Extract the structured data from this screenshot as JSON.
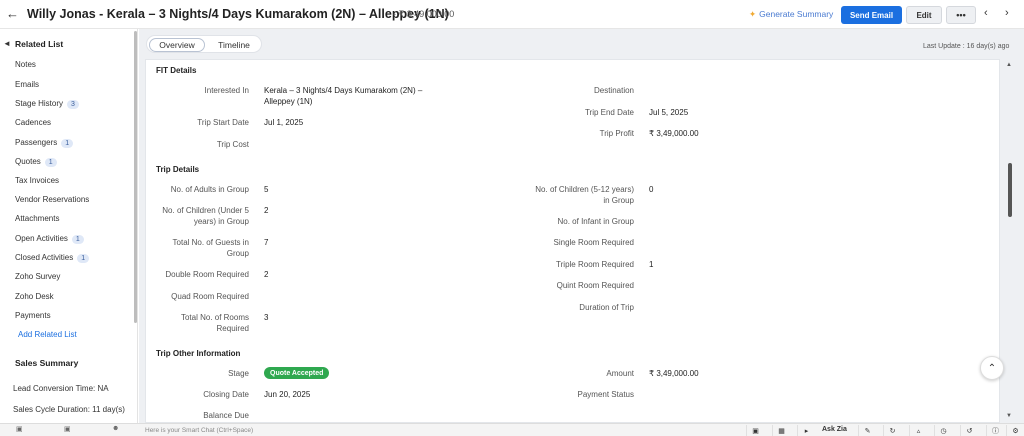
{
  "header": {
    "title": "Willy Jonas - Kerala – 3 Nights/4 Days Kumarakom (2N) – Alleppey (1N)",
    "amount": "- ₹ 3,49,000.00",
    "generate_summary": "Generate Summary",
    "send_email": "Send Email",
    "edit": "Edit",
    "more": "•••"
  },
  "sidebar": {
    "heading": "Related List",
    "items": [
      {
        "label": "Notes",
        "badge": ""
      },
      {
        "label": "Emails",
        "badge": ""
      },
      {
        "label": "Stage History",
        "badge": "3"
      },
      {
        "label": "Cadences",
        "badge": ""
      },
      {
        "label": "Passengers",
        "badge": "1"
      },
      {
        "label": "Quotes",
        "badge": "1"
      },
      {
        "label": "Tax Invoices",
        "badge": ""
      },
      {
        "label": "Vendor Reservations",
        "badge": ""
      },
      {
        "label": "Attachments",
        "badge": ""
      },
      {
        "label": "Open Activities",
        "badge": "1"
      },
      {
        "label": "Closed Activities",
        "badge": "1"
      },
      {
        "label": "Zoho Survey",
        "badge": ""
      },
      {
        "label": "Zoho Desk",
        "badge": ""
      },
      {
        "label": "Payments",
        "badge": ""
      }
    ],
    "add_related": "Add Related List",
    "sales_summary": "Sales Summary",
    "lead_conversion": "Lead Conversion Time: NA",
    "sales_cycle": "Sales Cycle Duration: 11 day(s)"
  },
  "tabs": {
    "overview": "Overview",
    "timeline": "Timeline"
  },
  "last_update": "Last Update : 16 day(s) ago",
  "fit": {
    "title": "FIT Details",
    "interested_in_label": "Interested In",
    "interested_in_value_1": "Kerala – 3 Nights/4 Days Kumarakom (2N) –",
    "interested_in_value_2": "Alleppey (1N)",
    "trip_start_label": "Trip Start Date",
    "trip_start_value": "Jul 1, 2025",
    "trip_cost_label": "Trip Cost",
    "destination_label": "Destination",
    "trip_end_label": "Trip End Date",
    "trip_end_value": "Jul 5, 2025",
    "trip_profit_label": "Trip Profit",
    "trip_profit_value": "₹ 3,49,000.00"
  },
  "trip": {
    "title": "Trip Details",
    "adults_label": "No. of Adults in Group",
    "adults_value": "5",
    "children_u5_label_1": "No. of Children (Under 5",
    "children_u5_label_2": "years) in Group",
    "children_u5_value": "2",
    "total_guests_label_1": "Total No. of Guests in",
    "total_guests_label_2": "Group",
    "total_guests_value": "7",
    "double_label": "Double Room Required",
    "double_value": "2",
    "quad_label": "Quad Room Required",
    "total_rooms_label_1": "Total No. of Rooms",
    "total_rooms_label_2": "Required",
    "total_rooms_value": "3",
    "children_512_label_1": "No. of Children (5-12 years)",
    "children_512_label_2": "in Group",
    "children_512_value": "0",
    "infant_label": "No. of Infant in Group",
    "single_label": "Single Room Required",
    "triple_label": "Triple Room Required",
    "triple_value": "1",
    "quint_label": "Quint Room Required",
    "duration_label": "Duration of Trip"
  },
  "other": {
    "title": "Trip Other Information",
    "stage_label": "Stage",
    "stage_value": "Quote Accepted",
    "closing_label": "Closing Date",
    "closing_value": "Jun 20, 2025",
    "balance_label": "Balance Due",
    "amount_label": "Amount",
    "amount_value": "₹ 3,49,000.00",
    "payment_label": "Payment Status"
  },
  "bottom": {
    "chat_placeholder": "Here is your Smart Chat (Ctrl+Space)",
    "ask_zia": "Ask Zia"
  },
  "colors": {
    "primary": "#1b6fe0",
    "stage_green": "#2fa84f"
  }
}
